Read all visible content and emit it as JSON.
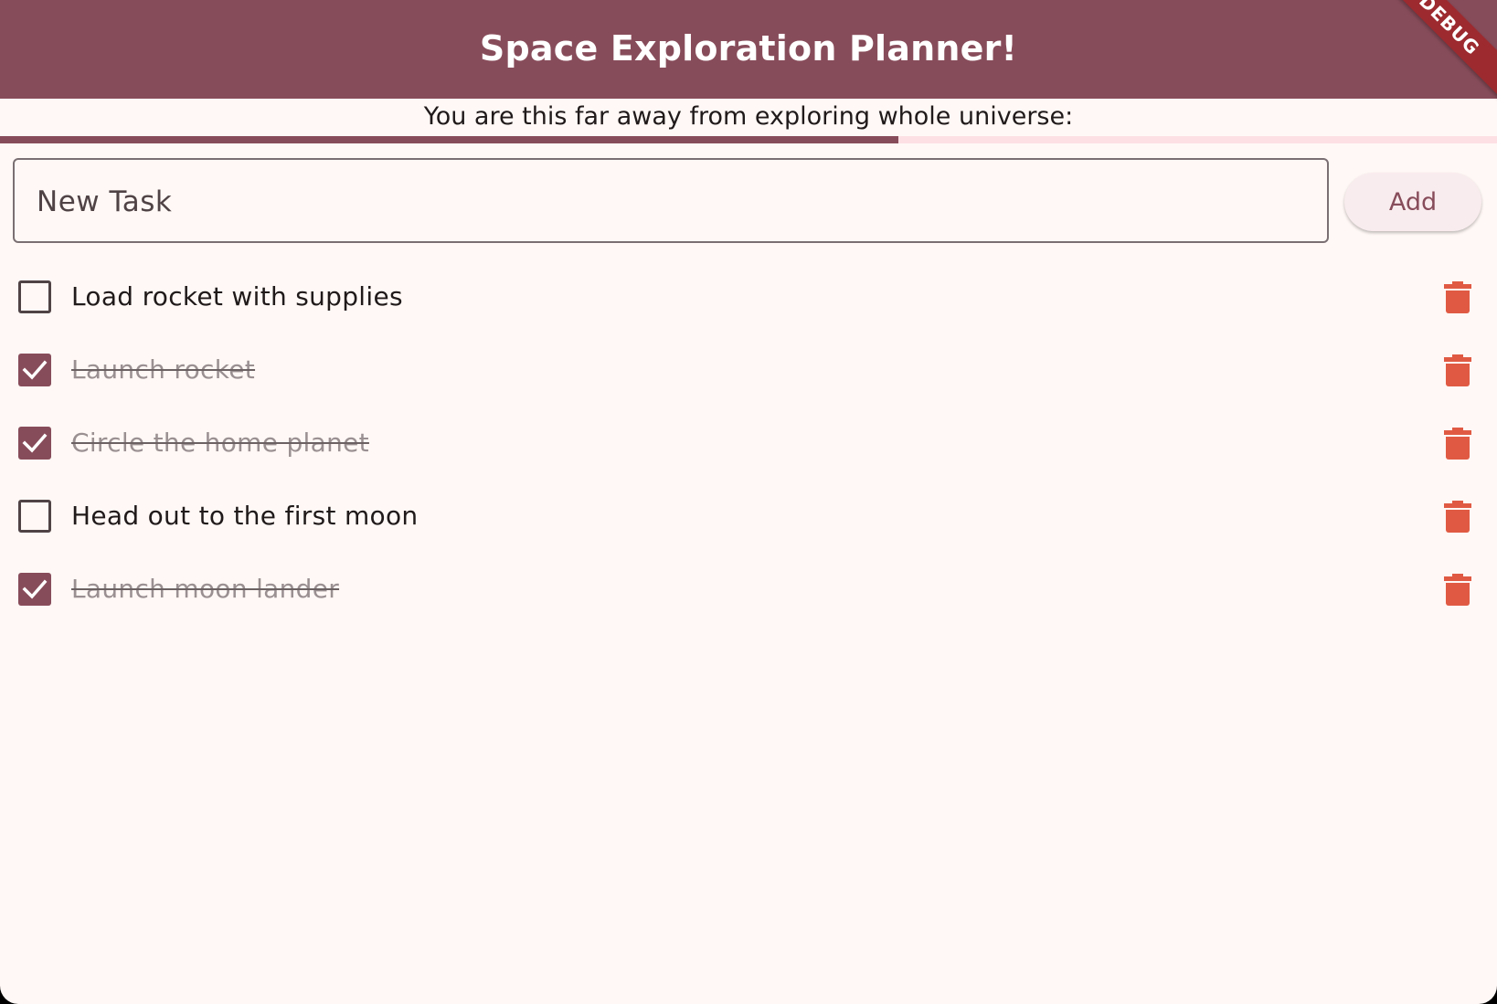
{
  "app": {
    "title": "Space Exploration Planner!",
    "debug_label": "DEBUG"
  },
  "progress": {
    "label": "You are this far away from exploring whole universe:",
    "fraction": 0.6,
    "fill_color": "#874c5a",
    "track_color": "#fde0e4"
  },
  "new_task": {
    "placeholder": "New Task",
    "value": "",
    "add_label": "Add"
  },
  "tasks": [
    {
      "label": "Load rocket with supplies",
      "done": false
    },
    {
      "label": "Launch rocket",
      "done": true
    },
    {
      "label": "Circle the home planet",
      "done": true
    },
    {
      "label": "Head out to the first moon",
      "done": false
    },
    {
      "label": "Launch moon lander",
      "done": true
    }
  ],
  "icons": {
    "delete": "trash-icon",
    "check": "check-icon"
  },
  "colors": {
    "primary": "#874c5a",
    "background": "#fff8f6",
    "delete": "#e05a43"
  }
}
